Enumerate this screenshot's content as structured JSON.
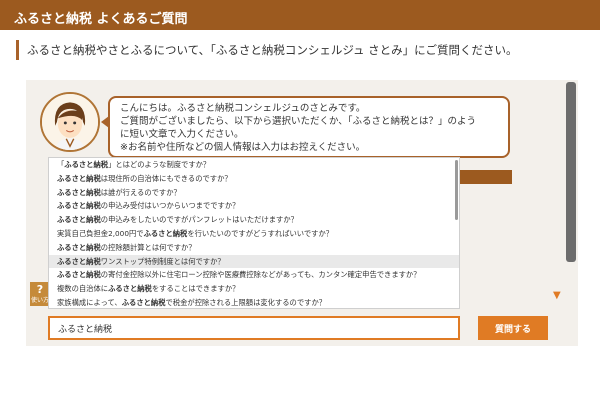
{
  "header": {
    "title": "ふるさと納税 よくあるご質問"
  },
  "intro": {
    "text": "ふるさと納税やさとふるについて、「ふるさと納税コンシェルジュ さとみ」にご質問ください。"
  },
  "bot": {
    "lines": [
      "こんにちは。ふるさと納税コンシェルジュのさとみです。",
      "ご質問がございましたら、以下から選択いただくか、「ふるさと納税とは？」のよう",
      "に短い文章で入力ください。",
      "※お名前や住所などの個人情報は入力はお控えください。"
    ]
  },
  "help": {
    "icon": "?",
    "label": "使い方"
  },
  "suggestions": [
    {
      "pre": "「",
      "hl": "ふるさと納税",
      "post": "」とはどのような制度ですか？"
    },
    {
      "pre": "",
      "hl": "ふるさと納税",
      "post": "は現住所の自治体にもできるのですか？"
    },
    {
      "pre": "",
      "hl": "ふるさと納税",
      "post": "は誰が行えるのですか？"
    },
    {
      "pre": "",
      "hl": "ふるさと納税",
      "post": "の申込み受付はいつからいつまでですか？"
    },
    {
      "pre": "",
      "hl": "ふるさと納税",
      "post": "の申込みをしたいのですがパンフレットはいただけますか？"
    },
    {
      "pre": "実質自己負担金2,000円で",
      "hl": "ふるさと納税",
      "post": "を行いたいのですがどうすればいいですか？"
    },
    {
      "pre": "",
      "hl": "ふるさと納税",
      "post": "の控除額計算とは何ですか？"
    },
    {
      "pre": "",
      "hl": "ふるさと納税",
      "post": "ワンストップ特例制度とは何ですか？"
    },
    {
      "pre": "",
      "hl": "ふるさと納税",
      "post": "の寄付金控除以外に住宅ローン控除や医療費控除などがあっても、カンタン確定申告できますか？"
    },
    {
      "pre": "複数の自治体に",
      "hl": "ふるさと納税",
      "post": "をすることはできますか？"
    },
    {
      "pre": "家族構成によって、",
      "hl": "ふるさと納税",
      "post": "で税金が控除される上限額は変化するのですか？"
    }
  ],
  "active_suggestion": 7,
  "search": {
    "value": "ふるさと納税"
  },
  "submit": {
    "label": "質問する"
  },
  "colors": {
    "header": "#9c5a1f",
    "accent": "#e07b24",
    "frame_bg": "#f3f0eb"
  },
  "icons": {
    "avatar": "concierge-avatar",
    "scroll_down": "triangle-down-icon",
    "help": "question-icon"
  }
}
